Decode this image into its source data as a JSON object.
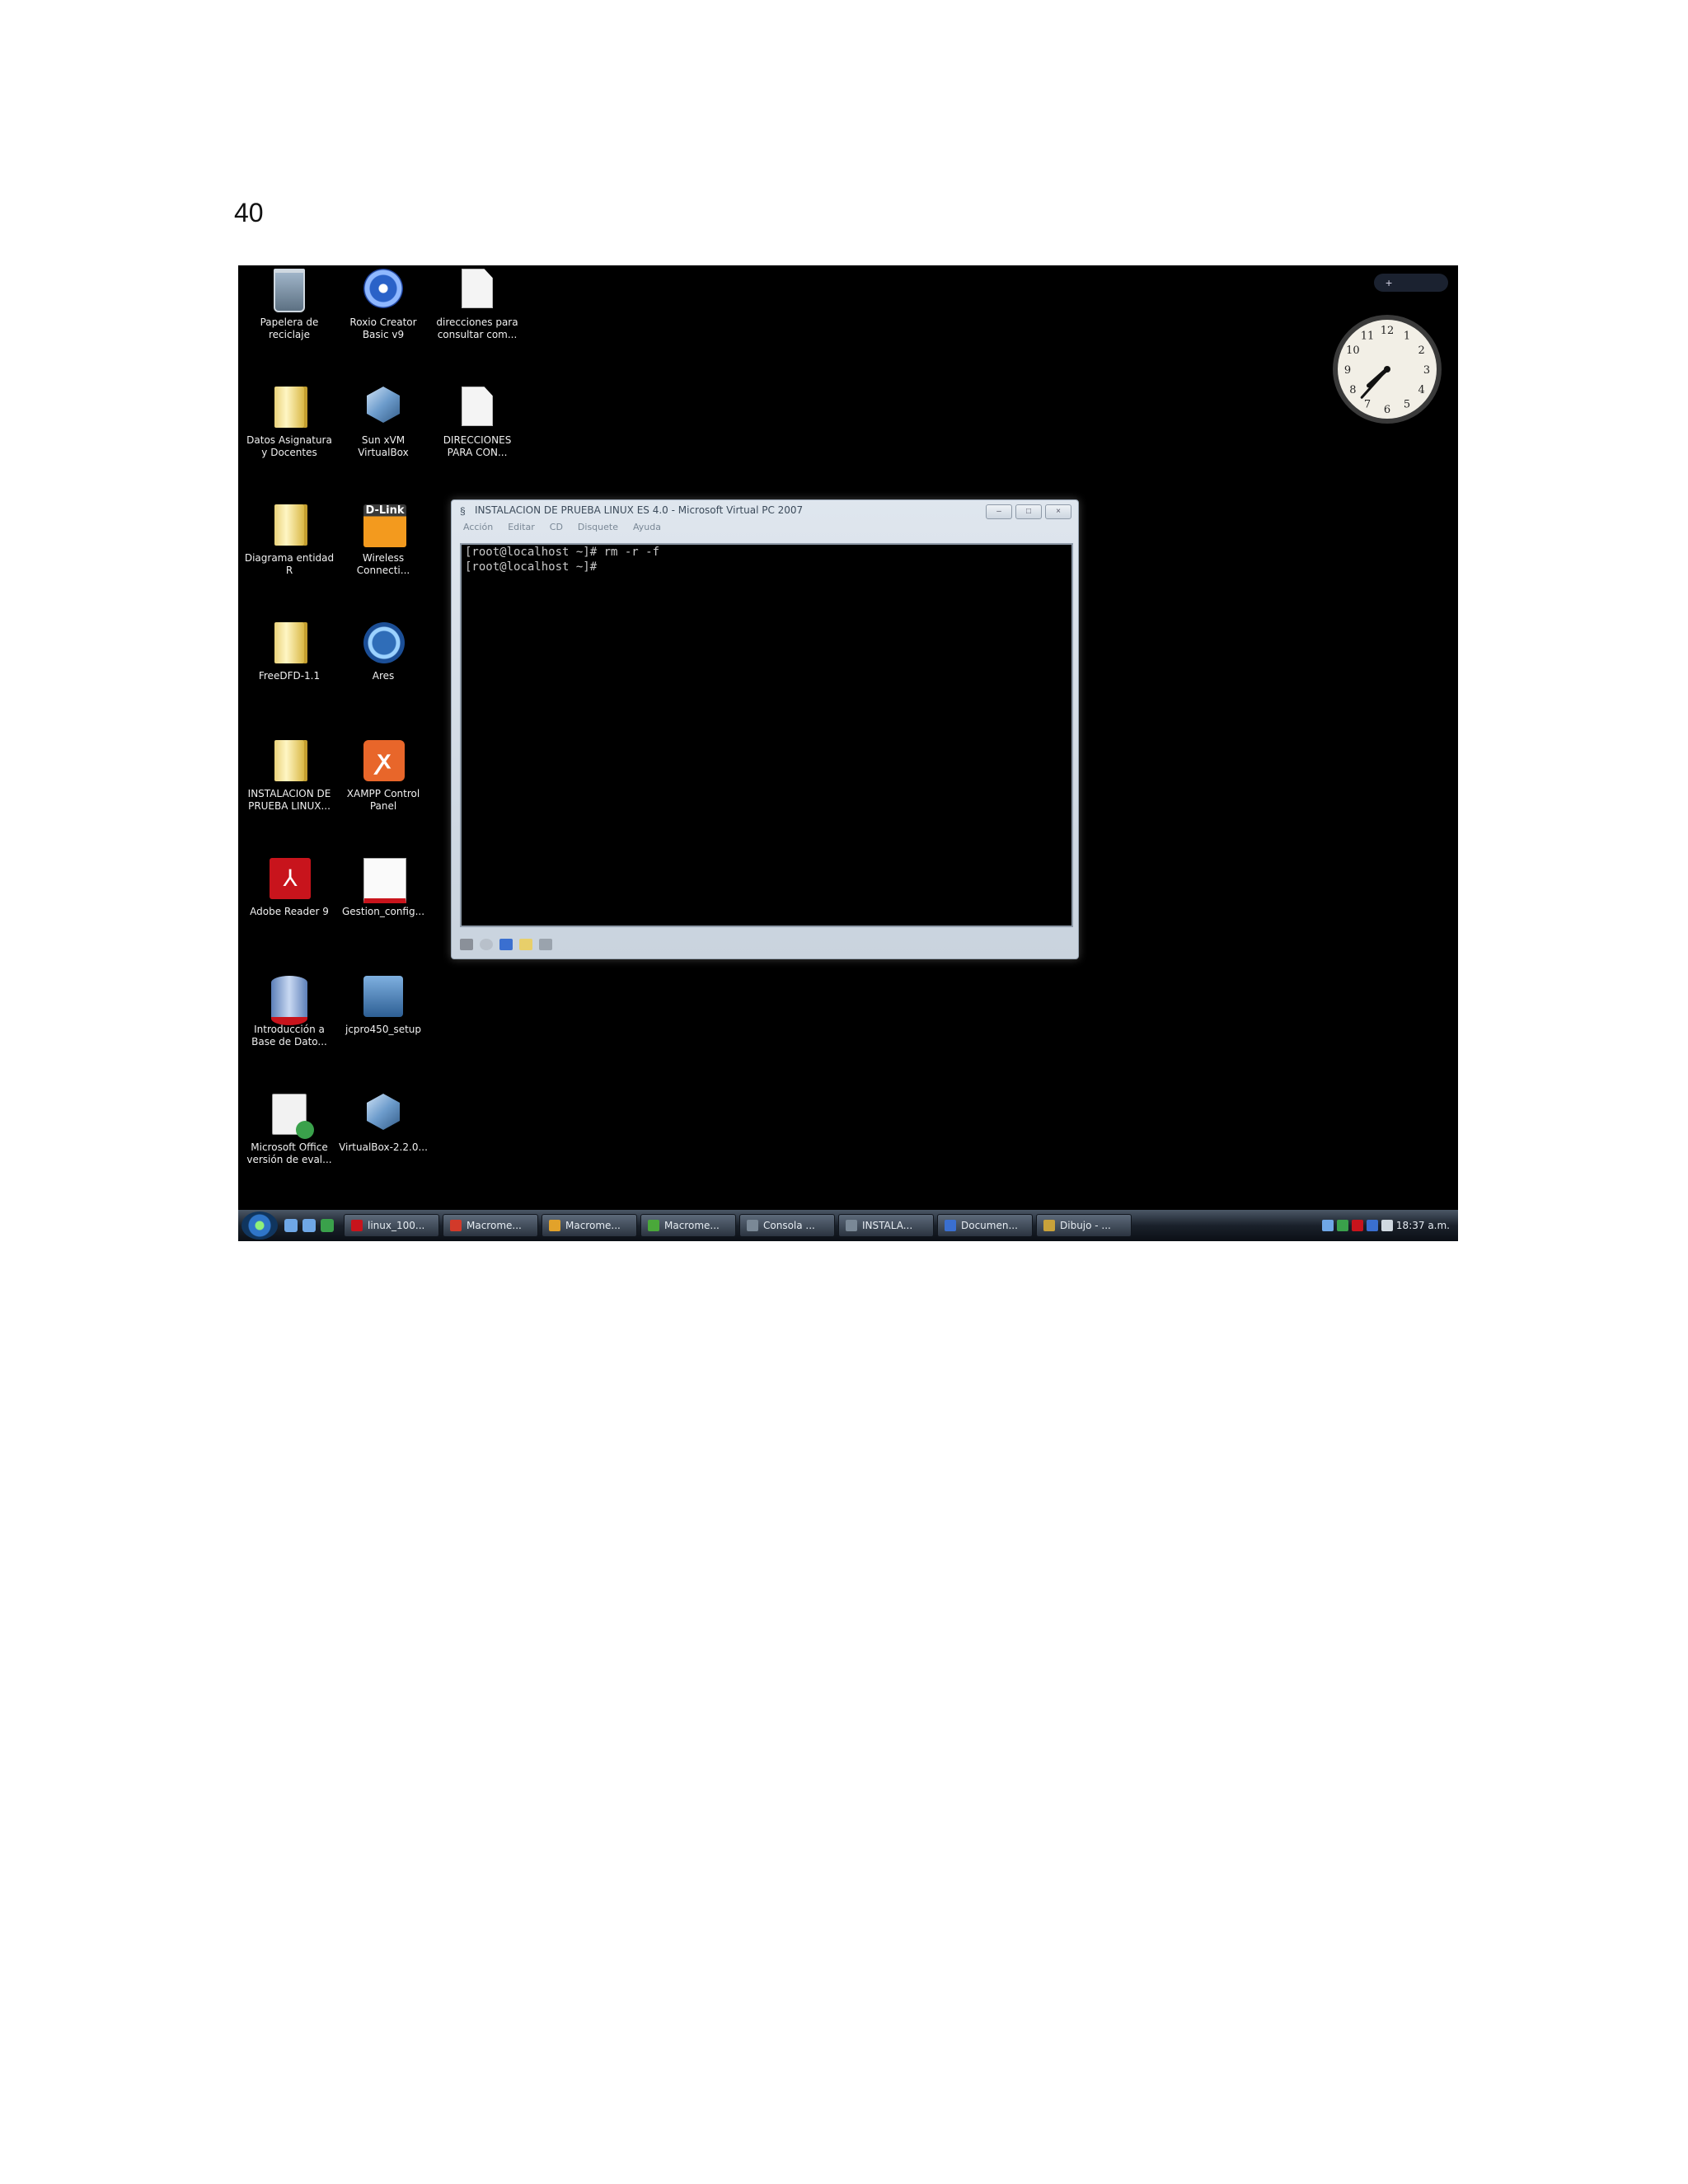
{
  "page": {
    "number": "40"
  },
  "desktop": {
    "icons": [
      {
        "label": "Papelera de reciclaje"
      },
      {
        "label": "Roxio Creator Basic v9"
      },
      {
        "label": "direcciones para consultar com..."
      },
      {
        "label": "Datos Asignatura y Docentes"
      },
      {
        "label": "Sun xVM VirtualBox"
      },
      {
        "label": "DIRECCIONES PARA CON..."
      },
      {
        "label": "Diagrama entidad R"
      },
      {
        "label": "Wireless Connecti...",
        "badge": "D-Link"
      },
      {
        "label": "FreeDFD-1.1"
      },
      {
        "label": "Ares"
      },
      {
        "label": "INSTALACION DE PRUEBA LINUX..."
      },
      {
        "label": "XAMPP Control Panel"
      },
      {
        "label": "Adobe Reader 9"
      },
      {
        "label": "Gestion_config..."
      },
      {
        "label": "Introducción a Base de Dato..."
      },
      {
        "label": "jcpro450_setup"
      },
      {
        "label": "Microsoft Office versión de eval..."
      },
      {
        "label": "VirtualBox-2.2.0..."
      }
    ]
  },
  "vm_window": {
    "title": "INSTALACION DE PRUEBA LINUX ES 4.0 - Microsoft Virtual PC 2007",
    "menu": [
      "Acción",
      "Editar",
      "CD",
      "Disquete",
      "Ayuda"
    ],
    "terminal_lines": [
      "[root@localhost ~]# rm -r -f",
      "[root@localhost ~]#"
    ],
    "controls": {
      "minimize": "–",
      "maximize": "□",
      "close": "×"
    }
  },
  "gadget": {
    "add_label": "+"
  },
  "clock": {
    "hour": 7,
    "minute": 37
  },
  "taskbar": {
    "tasks": [
      {
        "label": "linux_100...",
        "color": "#c8141c"
      },
      {
        "label": "Macrome...",
        "color": "#d23a2a"
      },
      {
        "label": "Macrome...",
        "color": "#e2a22a"
      },
      {
        "label": "Macrome...",
        "color": "#4aa83a"
      },
      {
        "label": "Consola ...",
        "color": "#7a8896"
      },
      {
        "label": "INSTALA...",
        "color": "#7a8896"
      },
      {
        "label": "Documen...",
        "color": "#3a6fd0"
      },
      {
        "label": "Dibujo - ...",
        "color": "#c9a23a"
      }
    ],
    "clock": "18:37 a.m."
  }
}
